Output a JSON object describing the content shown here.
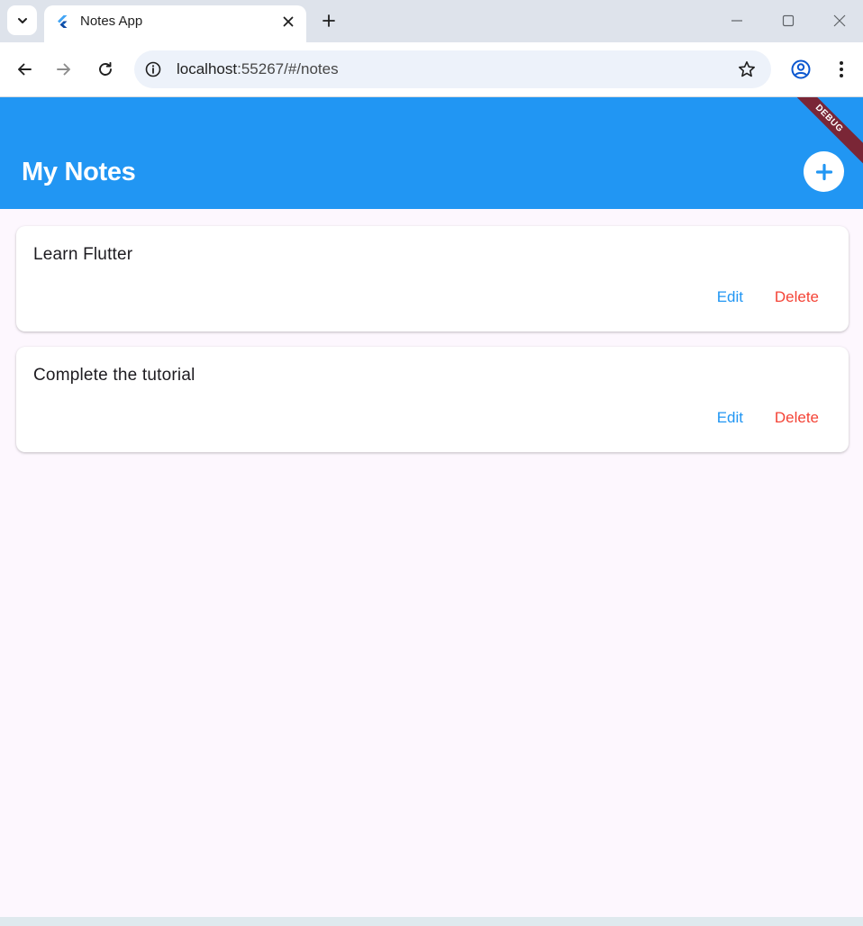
{
  "browser": {
    "tab": {
      "title": "Notes App"
    },
    "url": {
      "host": "localhost",
      "path": ":55267/#/notes"
    }
  },
  "app": {
    "title": "My Notes",
    "debug_banner": "DEBUG",
    "colors": {
      "appbar": "#2196f3",
      "edit": "#2196f3",
      "delete": "#f44336",
      "background": "#fdf7fe"
    },
    "notes": [
      {
        "title": "Learn Flutter",
        "edit_label": "Edit",
        "delete_label": "Delete"
      },
      {
        "title": "Complete the tutorial",
        "edit_label": "Edit",
        "delete_label": "Delete"
      }
    ]
  }
}
